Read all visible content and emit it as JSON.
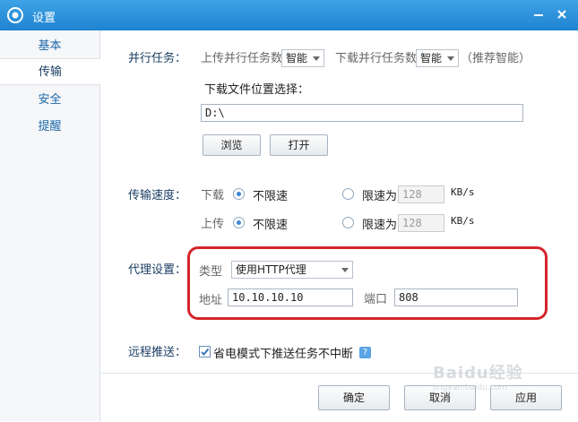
{
  "window": {
    "title": "设置"
  },
  "sidebar": {
    "items": [
      {
        "label": "基本"
      },
      {
        "label": "传输"
      },
      {
        "label": "安全"
      },
      {
        "label": "提醒"
      }
    ]
  },
  "parallel": {
    "label": "并行任务：",
    "upload_label": "上传并行任务数",
    "upload_value": "智能",
    "download_label": "下载并行任务数",
    "download_value": "智能",
    "hint": "（推荐智能）",
    "location_label": "下载文件位置选择：",
    "path": "D:\\",
    "browse_label": "浏览",
    "open_label": "打开"
  },
  "speed": {
    "label": "传输速度：",
    "download_label": "下载",
    "upload_label": "上传",
    "unlimited_label": "不限速",
    "limit_label": "限速为",
    "download_limit": "128",
    "upload_limit": "128",
    "unit": "KB/s"
  },
  "proxy": {
    "label": "代理设置：",
    "type_label": "类型",
    "type_value": "使用HTTP代理",
    "address_label": "地址",
    "address_value": "10.10.10.10",
    "port_label": "端口",
    "port_value": "808"
  },
  "remote": {
    "label": "远程推送：",
    "option_label": "省电模式下推送任务不中断",
    "help_text": "?"
  },
  "footer": {
    "ok_label": "确定",
    "cancel_label": "取消",
    "apply_label": "应用"
  },
  "watermark": {
    "text": "Baidu经验",
    "sub": "jingyan.baidu.com"
  },
  "colors": {
    "titlebar": "#2b91db",
    "link_blue": "#1b67a8",
    "highlight": "#d4252b"
  }
}
